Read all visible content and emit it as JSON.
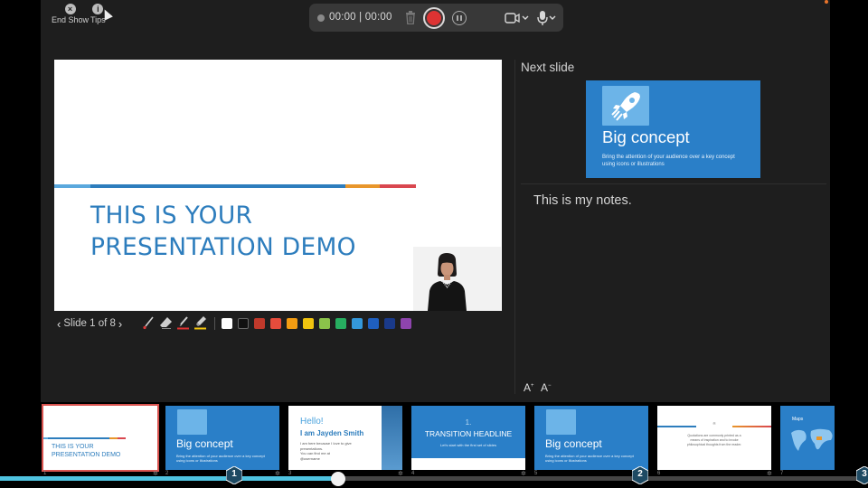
{
  "top_left": {
    "end_show": "End Show",
    "tips": "Tips"
  },
  "recording": {
    "time": "00:00 | 00:00"
  },
  "current_slide": {
    "title": "THIS IS YOUR\nPRESENTATION DEMO",
    "colors": {
      "bar_light_blue": "#5aa8dd",
      "bar_blue": "#2d7dbd",
      "bar_orange": "#e8962b",
      "bar_red": "#d9474f"
    }
  },
  "slide_nav": {
    "label": "Slide 1 of 8",
    "prev_icon": "chevron-left-icon",
    "next_icon": "chevron-right-icon"
  },
  "pen_tools": [
    "laser-pointer-icon",
    "eraser-icon",
    "pen-icon",
    "highlighter-icon"
  ],
  "ink_colors": [
    "#ffffff",
    "#111111",
    "#c0392b",
    "#e74c3c",
    "#f39c12",
    "#f1c40f",
    "#8bc34a",
    "#27ae60",
    "#3498db",
    "#1f5fbf",
    "#1a3a8a",
    "#8e44ad"
  ],
  "next_slide": {
    "label": "Next slide",
    "title": "Big concept",
    "subtitle": "Bring the attention of your audience over a key concept using icons or illustrations"
  },
  "notes": {
    "text": "This is my notes."
  },
  "font_controls": {
    "increase": "A",
    "decrease": "A"
  },
  "filmstrip": {
    "thumbnails": [
      {
        "num": "1",
        "title": "THIS IS YOUR\nPRESENTATION DEMO"
      },
      {
        "num": "2",
        "title": "Big concept",
        "sub": "Bring the attention of your audience over a key concept using icons or illustrations"
      },
      {
        "num": "3",
        "hello": "Hello!",
        "title": "I am Jayden Smith",
        "sub": "I am here because I love to give presentations.\nYou can find me at\n@username"
      },
      {
        "num": "4",
        "index": "1.",
        "title": "TRANSITION HEADLINE",
        "sub": "Let's start with the first set of slides"
      },
      {
        "num": "5",
        "title": "Big concept",
        "sub": "Bring the attention of your audience over a key concept using icons or illustrations"
      },
      {
        "num": "6",
        "quote": "Quotations are commonly printed as a means of inspiration and to invoke philosophical thoughts from the reader."
      },
      {
        "num": "7",
        "title": "Maps"
      }
    ],
    "progress": 0.39,
    "markers": [
      "1",
      "2",
      "3"
    ]
  }
}
